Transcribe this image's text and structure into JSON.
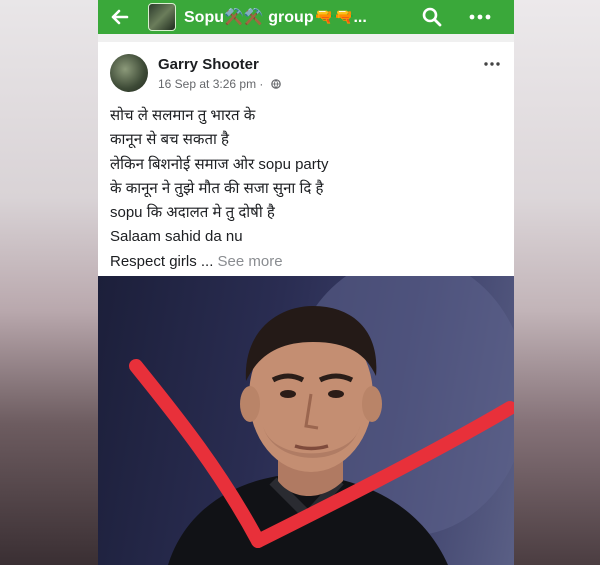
{
  "topbar": {
    "group_name": "Sopu⚒️⚒️ group🔫🔫..."
  },
  "post": {
    "author": "Garry Shooter",
    "timestamp": "16 Sep at 3:26 pm",
    "meta_separator": " · ",
    "lines": [
      "सोच ले सलमान तु भारत के",
      "कानून से बच सकता है",
      "लेकिन बिशनोई समाज ओर sopu party",
      "के कानून ने तुझे मौत की सजा सुना दि है",
      "sopu कि अदालत मे तु दोषी है",
      "Salaam sahid da nu"
    ],
    "last_line": "Respect girls ... ",
    "see_more": "See more"
  },
  "colors": {
    "topbar": "#3aa83a",
    "cross_mark": "#e8303a"
  }
}
